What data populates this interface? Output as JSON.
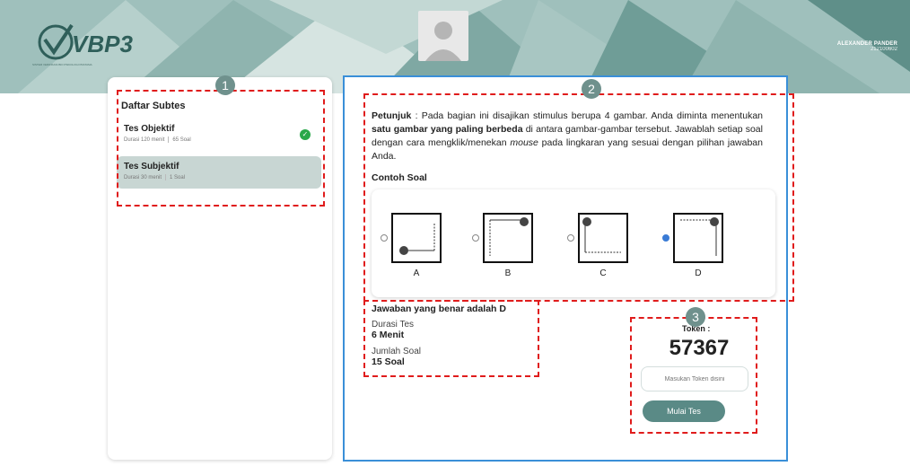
{
  "header": {
    "logo_text": "VBP3",
    "logo_subtitle": "SISTEM VERIFIKASI BIO PSIKOLOGI PRATAMA",
    "user_name": "ALEXANDER PANDER",
    "user_id": "212100602",
    "colors": {
      "header_bg": "#9fc0bc",
      "accent": "#5a8a86"
    }
  },
  "sidebar": {
    "title": "Daftar Subtes",
    "items": [
      {
        "label": "Tes Objektif",
        "duration": "Durasi 120 menit",
        "count": "65 Soal",
        "completed": true
      },
      {
        "label": "Tes Subjektif",
        "duration": "Durasi 30 menit",
        "count": "1 Soal",
        "completed": false
      }
    ]
  },
  "main": {
    "instruction_label": "Petunjuk",
    "instruction_part1": " : Pada bagian ini disajikan stimulus berupa 4 gambar. Anda diminta menentukan ",
    "instruction_bold": "satu gambar yang paling berbeda",
    "instruction_part2": " di antara gambar-gambar tersebut. Jawablah setiap soal dengan cara mengklik/menekan ",
    "instruction_italic": "mouse",
    "instruction_part3": " pada lingkaran yang sesuai dengan pilihan jawaban Anda.",
    "example_title": "Contoh Soal",
    "options": [
      {
        "label": "A",
        "selected": false
      },
      {
        "label": "B",
        "selected": false
      },
      {
        "label": "C",
        "selected": false
      },
      {
        "label": "D",
        "selected": true
      }
    ],
    "answer_text": "Jawaban yang benar adalah D",
    "duration_label": "Durasi Tes",
    "duration_value": "6 Menit",
    "question_count_label": "Jumlah Soal",
    "question_count_value": "15 Soal"
  },
  "token_panel": {
    "label": "Token :",
    "value": "57367",
    "input_placeholder": "Masukan Token disini",
    "start_button": "Mulai Tes"
  },
  "annotations": [
    {
      "number": "1"
    },
    {
      "number": "2"
    },
    {
      "number": "3"
    }
  ]
}
